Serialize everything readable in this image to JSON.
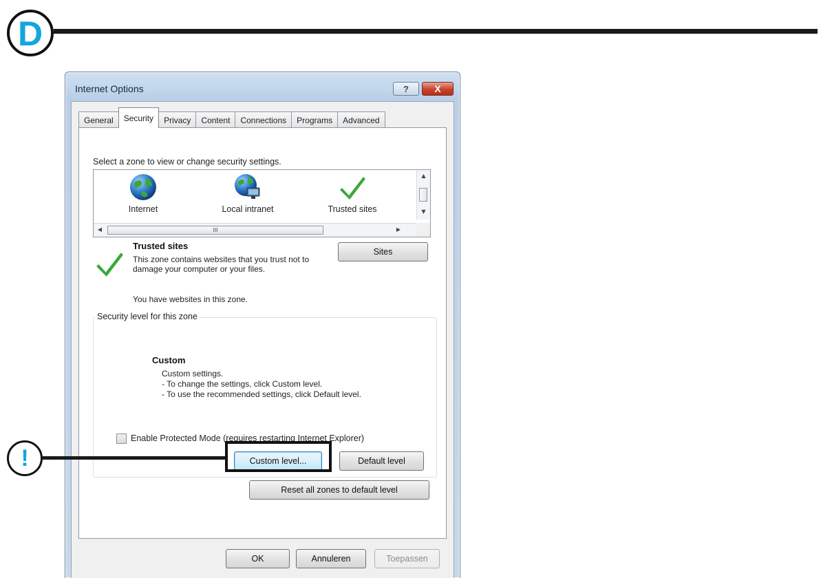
{
  "annotations": {
    "step_letter": "D",
    "warning_mark": "!"
  },
  "window": {
    "title": "Internet Options",
    "help_label": "?",
    "close_label": "X"
  },
  "tabs": [
    {
      "label": "General",
      "active": false
    },
    {
      "label": "Security",
      "active": true
    },
    {
      "label": "Privacy",
      "active": false
    },
    {
      "label": "Content",
      "active": false
    },
    {
      "label": "Connections",
      "active": false
    },
    {
      "label": "Programs",
      "active": false
    },
    {
      "label": "Advanced",
      "active": false
    }
  ],
  "security": {
    "zone_prompt": "Select a zone to view or change security settings.",
    "zones": [
      {
        "label": "Internet",
        "icon": "globe-icon"
      },
      {
        "label": "Local intranet",
        "icon": "intranet-globe-icon"
      },
      {
        "label": "Trusted sites",
        "icon": "check-icon",
        "selected": true
      }
    ],
    "hscroll_thumb_grip": "III",
    "selected_zone": {
      "title": "Trusted sites",
      "description": "This zone contains websites that you trust not to damage your computer or your files.",
      "status": "You have websites in this zone."
    },
    "sites_button": "Sites",
    "level_group_title": "Security level for this zone",
    "level": {
      "name": "Custom",
      "lines": [
        "Custom settings.",
        "- To change the settings, click Custom level.",
        "- To use the recommended settings, click Default level."
      ]
    },
    "protected_mode_label": "Enable Protected Mode (requires restarting Internet Explorer)",
    "protected_mode_checked": false,
    "custom_level_button": "Custom level...",
    "default_level_button": "Default level",
    "reset_button": "Reset all zones to default level"
  },
  "footer": {
    "ok": "OK",
    "cancel": "Annuleren",
    "apply": "Toepassen"
  },
  "colors": {
    "accent": "#12a6dc",
    "check_green": "#3aa83a",
    "close_red": "#c7432c"
  }
}
